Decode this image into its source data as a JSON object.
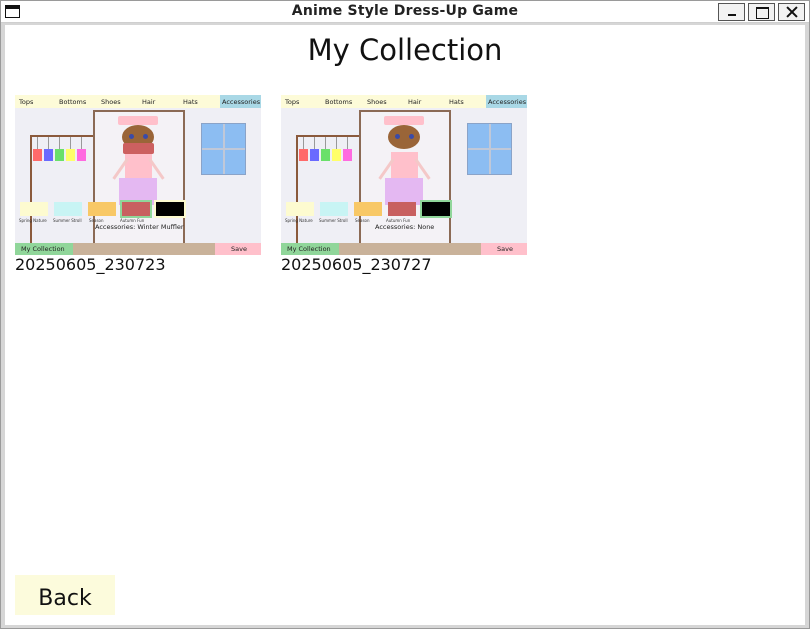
{
  "window": {
    "title": "Anime Style Dress-Up Game"
  },
  "page": {
    "title": "My Collection"
  },
  "collection": [
    {
      "caption": "20250605_230723",
      "tabs": [
        "Tops",
        "Bottoms",
        "Shoes",
        "Hair",
        "Hats",
        "Accessories"
      ],
      "swatch_labels": [
        "Spring Nature",
        "Summer Stroll",
        "Season",
        "Autumn Fun",
        ""
      ],
      "under_label": "Accessories: Winter Muffler",
      "collection_button": "My Collection",
      "save_button": "Save"
    },
    {
      "caption": "20250605_230727",
      "tabs": [
        "Tops",
        "Bottoms",
        "Shoes",
        "Hair",
        "Hats",
        "Accessories"
      ],
      "swatch_labels": [
        "Spring Nature",
        "Summer Stroll",
        "Season",
        "Autumn Fun",
        ""
      ],
      "under_label": "Accessories: None",
      "collection_button": "My Collection",
      "save_button": "Save"
    }
  ],
  "footer": {
    "back_label": "Back"
  },
  "colors": {
    "tab_bar": "#fdfbd8",
    "tab_active": "#a9d8e6",
    "shirt_colors": [
      "#ff6a6a",
      "#6a6aff",
      "#6ae06a",
      "#ffff6a",
      "#ff6ae0"
    ],
    "swatch_colors": [
      "#fdfbd0",
      "#c8f4f4",
      "#f8c866",
      "#c86060",
      "#000000"
    ],
    "collection_button": "#90d69a",
    "save_button": "#ffc0cb",
    "back_button": "#fcfbdc"
  }
}
